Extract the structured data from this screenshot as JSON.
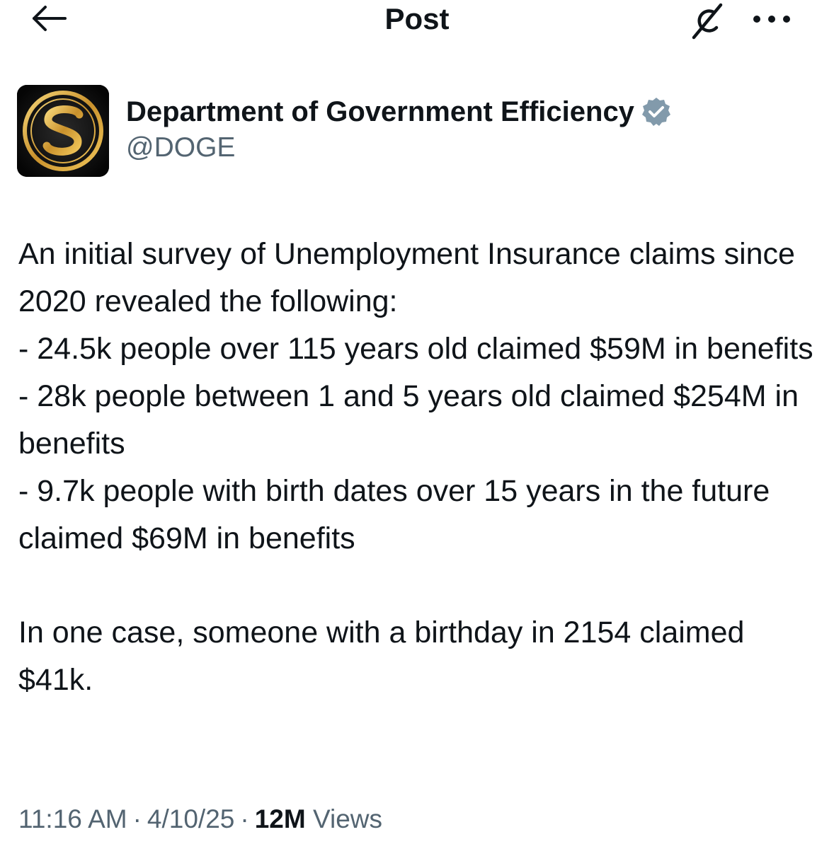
{
  "header": {
    "title": "Post",
    "back_icon": "arrow-left-icon",
    "grok_icon": "grok-icon",
    "more_icon": "more-horizontal-icon"
  },
  "author": {
    "display_name": "Department of Government Efficiency",
    "handle": "@DOGE",
    "verified_icon": "verified-badge-icon",
    "verified_color": "#829aab",
    "avatar_icon": "gold-dollar-coin-icon"
  },
  "post": {
    "lines": [
      "An initial survey of Unemployment Insurance claims since 2020 revealed the following:",
      "- 24.5k people over 115 years old claimed $59M in benefits",
      "- 28k people between 1 and 5 years old claimed $254M in benefits",
      "- 9.7k people with birth dates over 15 years in the future claimed $69M in benefits"
    ],
    "closing": "In one case, someone with a birthday in 2154 claimed $41k."
  },
  "meta": {
    "time": "11:16 AM",
    "date": "4/10/25",
    "views_count": "12M",
    "views_label": "Views",
    "separator": "·"
  },
  "colors": {
    "text": "#0f1419",
    "secondary": "#536471",
    "avatar_bg": "#111111",
    "gold": "#d4a23a"
  }
}
